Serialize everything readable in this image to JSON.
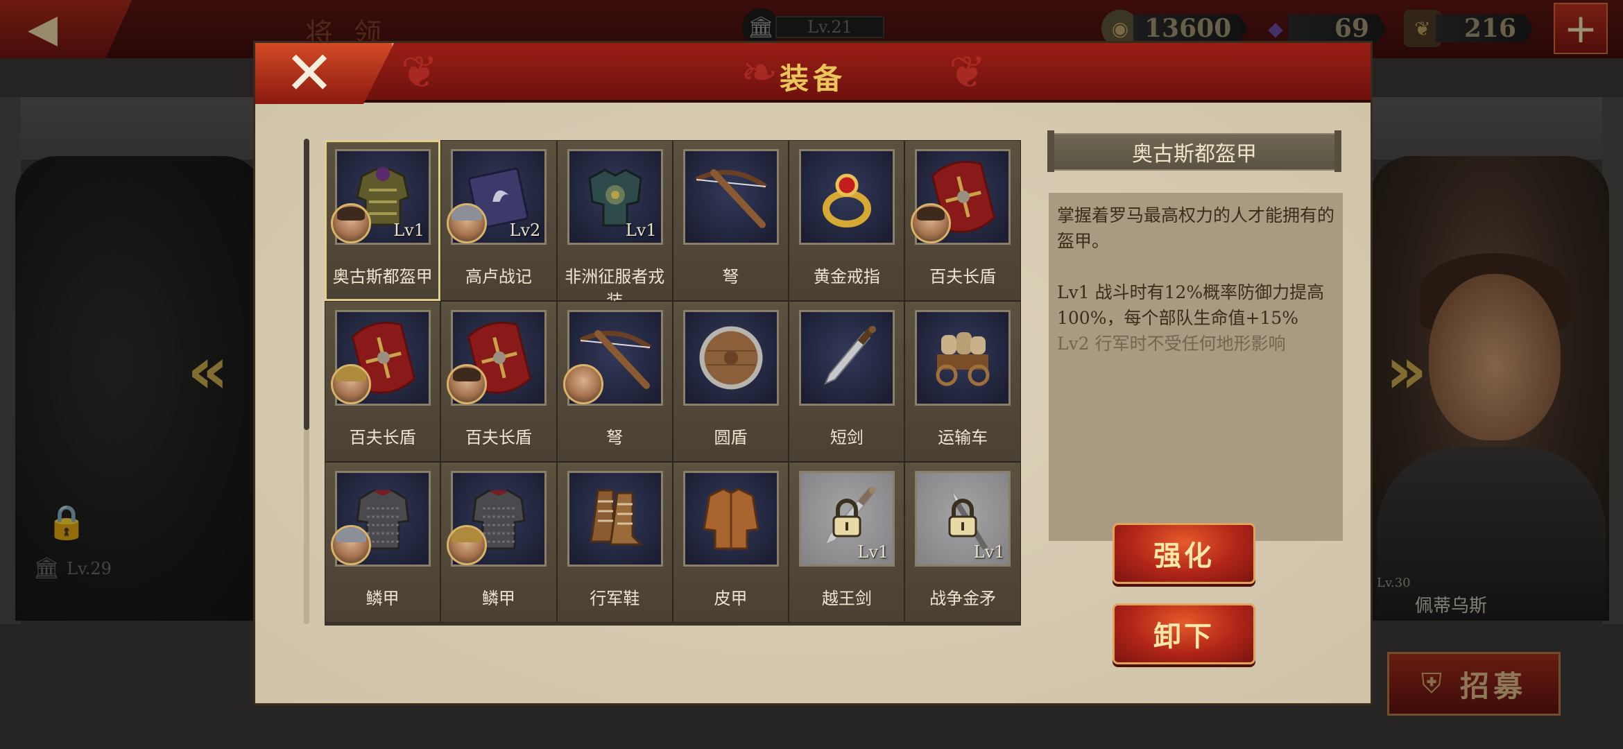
{
  "top_bar": {
    "page_title": "将领",
    "level": "Lv.21",
    "resources": [
      {
        "icon": "coin-icon",
        "value": "13600"
      },
      {
        "icon": "gem-icon",
        "value": "69"
      },
      {
        "icon": "laurel-badge-icon",
        "value": "216"
      }
    ]
  },
  "background": {
    "left_general_level": "Lv.29",
    "right_general_name": "佩蒂乌斯",
    "right_general_level": "Lv.30",
    "recruit_label": "招募"
  },
  "modal": {
    "title": "装备",
    "items": [
      {
        "name": "奥古斯都盔甲",
        "level": "Lv1",
        "icon": "armor-icon",
        "avatar": "hair",
        "selected": true
      },
      {
        "name": "高卢战记",
        "level": "Lv2",
        "icon": "book-icon",
        "avatar": "helmet"
      },
      {
        "name": "非洲征服者戎装",
        "level": "Lv1",
        "icon": "ornate-armor-icon",
        "avatar": ""
      },
      {
        "name": "弩",
        "level": "",
        "icon": "crossbow-icon",
        "avatar": ""
      },
      {
        "name": "黄金戒指",
        "level": "",
        "icon": "ring-icon",
        "avatar": ""
      },
      {
        "name": "百夫长盾",
        "level": "",
        "icon": "shield-icon",
        "avatar": "hair"
      },
      {
        "name": "百夫长盾",
        "level": "",
        "icon": "shield-icon",
        "avatar": "gold"
      },
      {
        "name": "百夫长盾",
        "level": "",
        "icon": "shield-icon",
        "avatar": "hair"
      },
      {
        "name": "弩",
        "level": "",
        "icon": "crossbow-icon",
        "avatar": "bald"
      },
      {
        "name": "圆盾",
        "level": "",
        "icon": "round-shield-icon",
        "avatar": ""
      },
      {
        "name": "短剑",
        "level": "",
        "icon": "sword-icon",
        "avatar": ""
      },
      {
        "name": "运输车",
        "level": "",
        "icon": "cart-icon",
        "avatar": ""
      },
      {
        "name": "鳞甲",
        "level": "",
        "icon": "chainmail-icon",
        "avatar": "helmet"
      },
      {
        "name": "鳞甲",
        "level": "",
        "icon": "chainmail-icon",
        "avatar": "gold"
      },
      {
        "name": "行军鞋",
        "level": "",
        "icon": "boots-icon",
        "avatar": ""
      },
      {
        "name": "皮甲",
        "level": "",
        "icon": "leather-armor-icon",
        "avatar": ""
      },
      {
        "name": "越王剑",
        "level": "Lv1",
        "icon": "sword-icon",
        "avatar": "",
        "locked": true
      },
      {
        "name": "战争金矛",
        "level": "Lv1",
        "icon": "spear-icon",
        "avatar": "",
        "locked": true
      }
    ],
    "detail": {
      "title": "奥古斯都盔甲",
      "intro": "掌握着罗马最高权力的人才能拥有的盔甲。",
      "lv1": "Lv1  战斗时有12%概率防御力提高100%，每个部队生命值+15%",
      "lv2": "Lv2  行军时不受任何地形影响"
    },
    "buttons": {
      "strengthen": "强化",
      "unequip": "卸下"
    }
  },
  "colors": {
    "header_red": "#8a1a12",
    "title_gold": "#e9c55a",
    "button_red": "#b12518",
    "panel_bg": "#d8cdb4",
    "desc_bg": "#a79b81"
  }
}
